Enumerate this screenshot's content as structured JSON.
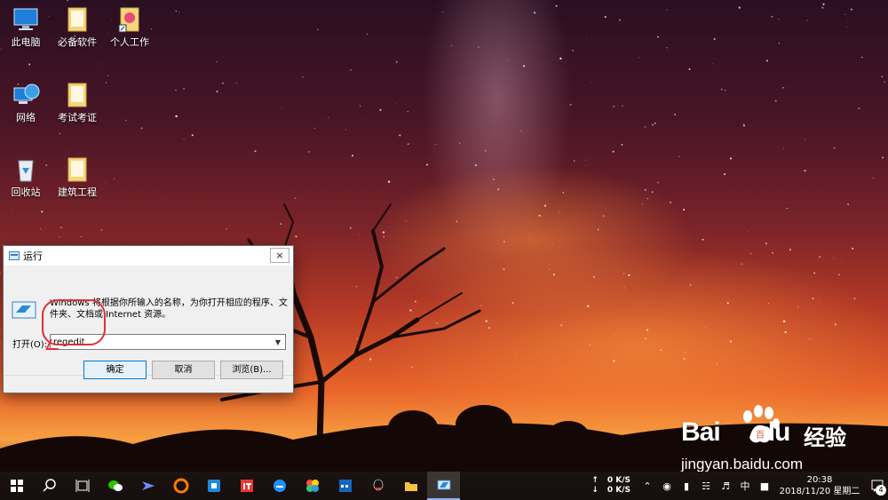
{
  "desktop": {
    "icons": [
      {
        "label": "此电脑",
        "icon": "computer-icon"
      },
      {
        "label": "必备软件",
        "icon": "folder-icon"
      },
      {
        "label": "个人工作",
        "icon": "folder-shortcut-icon"
      },
      {
        "label": "网络",
        "icon": "network-icon"
      },
      {
        "label": "考试考证",
        "icon": "folder-icon"
      },
      {
        "label": "回收站",
        "icon": "recycle-bin-icon"
      },
      {
        "label": "建筑工程",
        "icon": "folder-icon"
      }
    ]
  },
  "run_dialog": {
    "title": "运行",
    "close": "×",
    "description": "Windows 将根据你所输入的名称，为你打开相应的程序、文件夹、文档或 Internet 资源。",
    "open_label": "打开(O):",
    "open_value": "regedit",
    "ok_label": "确定",
    "cancel_label": "取消",
    "browse_label": "浏览(B)..."
  },
  "taskbar": {
    "apps": [
      "start-icon",
      "search-icon",
      "task-view-icon",
      "wechat-icon",
      "feishu-icon",
      "browser-icon",
      "office-icon",
      "ithome-icon",
      "edge-icon",
      "photos-icon",
      "calendar-icon",
      "qq-icon",
      "file-explorer-icon",
      "run-icon"
    ],
    "upload_speed": "0 K/S",
    "download_speed": "0 K/S",
    "ime": "中",
    "time": "20:38",
    "date": "2018/11/20 星期二",
    "notification_count": "4"
  },
  "watermark": {
    "brand": "Bai",
    "brand_suffix": "百",
    "cn_text": "经验",
    "url": "jingyan.baidu.com"
  },
  "colors": {
    "accent": "#0078d7",
    "annotation": "#e0303a"
  }
}
